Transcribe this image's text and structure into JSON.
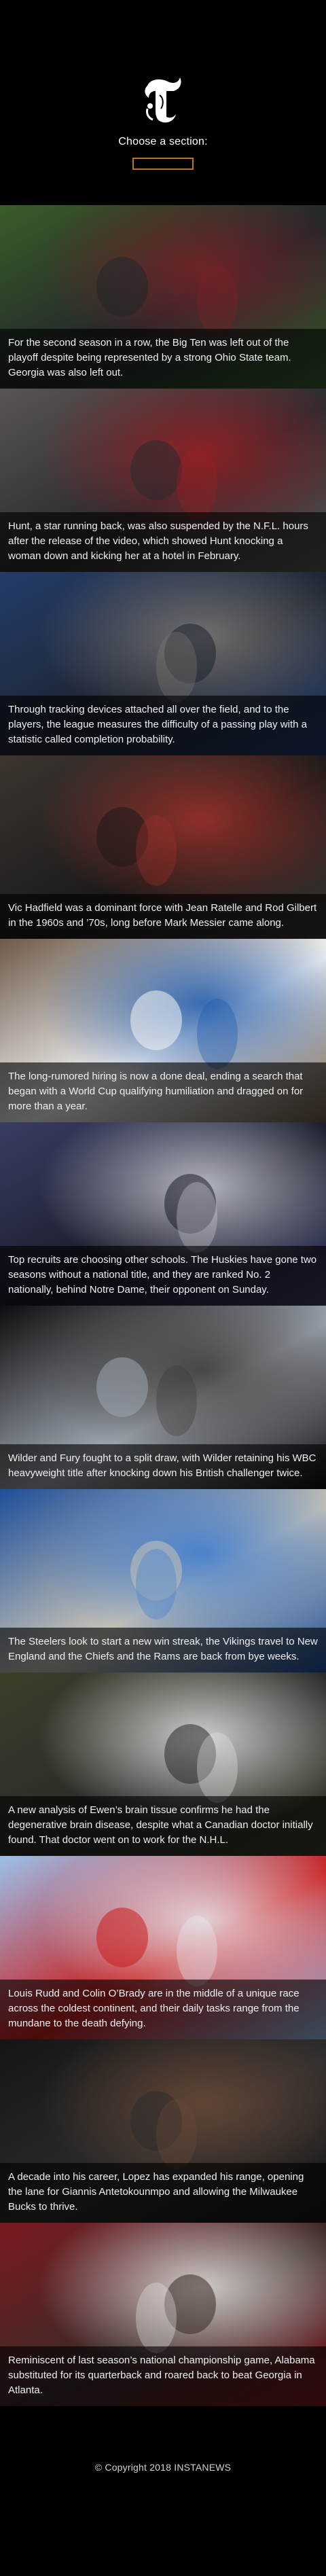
{
  "header": {
    "logo": "nyt-t-logo",
    "choose_label": "Choose a section:",
    "section_select_value": ""
  },
  "stories": [
    {
      "caption": "For the second season in a row, the Big Ten was left out of the playoff despite being represented by a strong Ohio State team. Georgia was also left out.",
      "colors": [
        "#3b5c2a",
        "#7b2228",
        "#20262a"
      ]
    },
    {
      "caption": "Hunt, a star running back, was also suspended by the N.F.L. hours after the release of the video, which showed Hunt knocking a woman down and kicking her at a hotel in February.",
      "colors": [
        "#5a5552",
        "#9a2025",
        "#2a2a2e"
      ]
    },
    {
      "caption": "Through tracking devices attached all over the field, and to the players, the league measures the difficulty of a passing play with a statistic called completion probability.",
      "colors": [
        "#243c6a",
        "#7e7a76",
        "#1d2430"
      ]
    },
    {
      "caption": "Vic Hadfield was a dominant force with Jean Ratelle and Rod Gilbert in the 1960s and ’70s, long before Mark Messier came along.",
      "colors": [
        "#3c3530",
        "#a1322c",
        "#1c1a19"
      ]
    },
    {
      "caption": "The long-rumored hiring is now a done deal, ending a search that began with a World Cup qualifying humiliation and dragged on for more than a year.",
      "colors": [
        "#6d5a4a",
        "#1a56a8",
        "#f4f4f4"
      ]
    },
    {
      "caption": "Top recruits are choosing other schools. The Huskies have gone two seasons without a national title, and they are ranked No. 2 nationally, behind Notre Dame, their opponent on Sunday.",
      "colors": [
        "#3a3d63",
        "#cdd0d7",
        "#1a1c2a"
      ]
    },
    {
      "caption": "Wilder and Fury fought to a split draw, with Wilder retaining his WBC heavyweight title after knocking down his British challenger twice.",
      "colors": [
        "#0d0d0e",
        "#3d3a37",
        "#9ea6b0"
      ]
    },
    {
      "caption": "The Steelers look to start a new win streak, the Vikings travel to New England and the Chiefs and the Rams are back from bye weeks.",
      "colors": [
        "#1d4f9a",
        "#3a7ad0",
        "#c6c2b6"
      ]
    },
    {
      "caption": "A new analysis of Ewen’s brain tissue confirms he had the degenerative brain disease, despite what a Canadian doctor initially found. That doctor went on to work for the N.H.L.",
      "colors": [
        "#3d3e2a",
        "#e8e8e6",
        "#2a2a28"
      ]
    },
    {
      "caption": "Louis Rudd and Colin O’Brady are in the middle of a unique race across the coldest continent, and their daily tasks range from the mundane to the death defying.",
      "colors": [
        "#9cc0ea",
        "#e9eef4",
        "#c81e1e"
      ]
    },
    {
      "caption": "A decade into his career, Lopez has expanded his range, opening the lane for Giannis Antetokounmpo and allowing the Milwaukee Bucks to thrive.",
      "colors": [
        "#151515",
        "#6a4a38",
        "#2c2c2c"
      ]
    },
    {
      "caption": "Reminiscent of last season’s national championship game, Alabama substituted for its quarterback and roared back to beat Georgia in Atlanta.",
      "colors": [
        "#7a1a22",
        "#e8e6e4",
        "#3a2a26"
      ]
    }
  ],
  "footer": {
    "copyright": "© Copyright 2018 INSTANEWS"
  }
}
